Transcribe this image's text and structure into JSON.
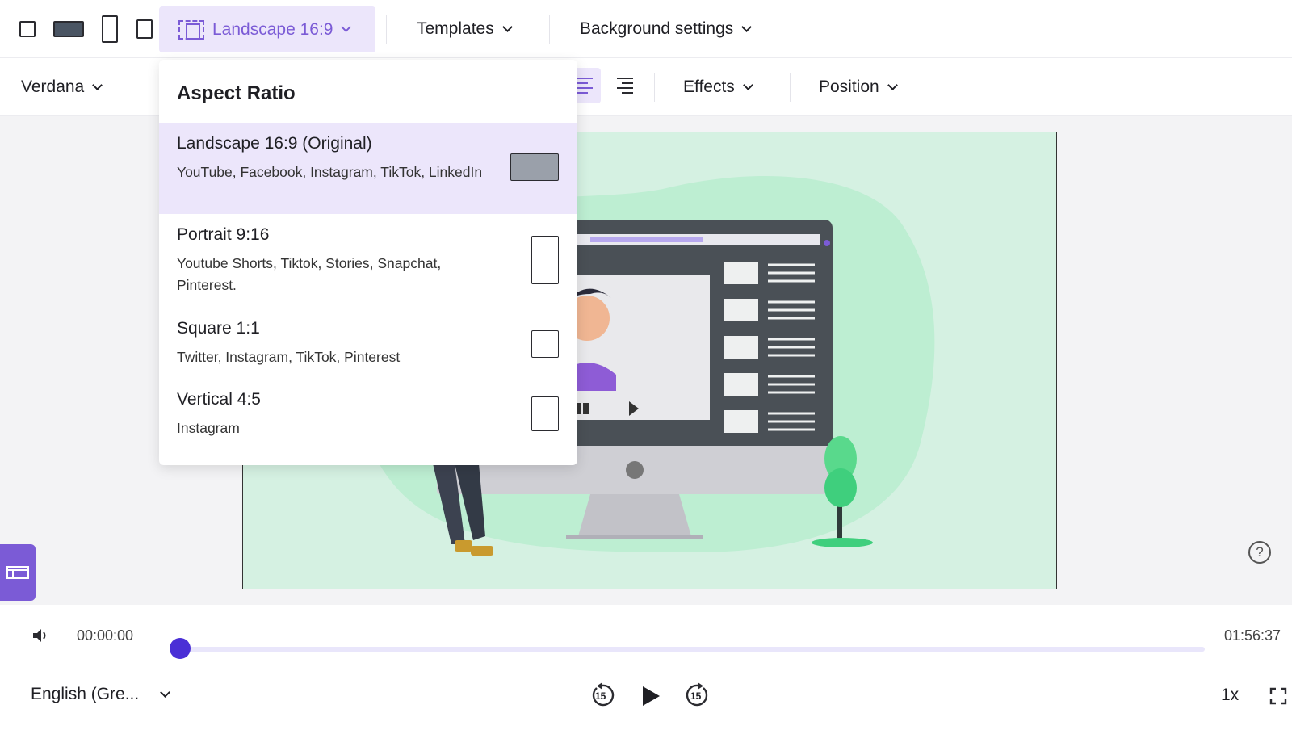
{
  "topbar": {
    "aspect_button_label": "Landscape 16:9",
    "templates_label": "Templates",
    "background_label": "Background settings"
  },
  "toolbar2": {
    "font_label": "Verdana",
    "effects_label": "Effects",
    "position_label": "Position"
  },
  "aspect_dropdown": {
    "title": "Aspect Ratio",
    "options": [
      {
        "name": "Landscape 16:9 (Original)",
        "desc": "YouTube, Facebook, Instagram, TikTok, LinkedIn",
        "selected": true
      },
      {
        "name": "Portrait 9:16",
        "desc": "Youtube Shorts, Tiktok, Stories, Snapchat, Pinterest.",
        "selected": false
      },
      {
        "name": "Square 1:1",
        "desc": "Twitter, Instagram, TikTok, Pinterest",
        "selected": false
      },
      {
        "name": "Vertical 4:5",
        "desc": "Instagram",
        "selected": false
      }
    ]
  },
  "player": {
    "current_time": "00:00:00",
    "total_time": "01:56:37",
    "progress": 0,
    "language": "English (Gre...",
    "speed": "1x",
    "rewind_seconds": "15",
    "forward_seconds": "15"
  },
  "help": {
    "label": "?"
  },
  "colors": {
    "accent": "#7b5bd6",
    "accent_light": "#ece6fb",
    "thumb": "#4a2fd6",
    "video_bg": "#d5f1e2"
  }
}
